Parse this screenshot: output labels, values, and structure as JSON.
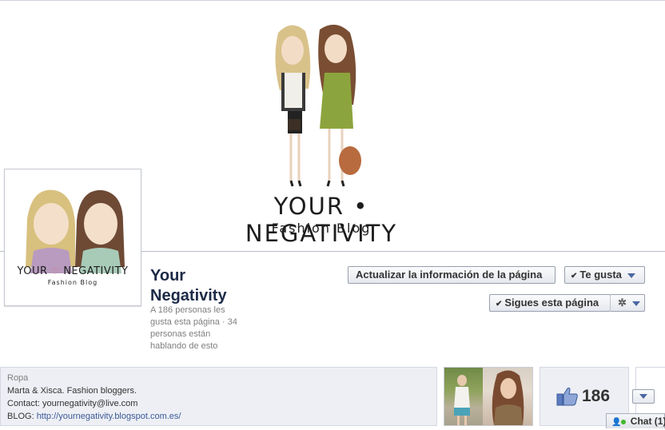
{
  "cover": {
    "brand": "YOUR • NEGATIVITY",
    "subtitle": "Fashion Blog"
  },
  "profile": {
    "brand_left": "YOUR",
    "heart": "♡",
    "brand_right": "NEGATIVITY",
    "subtitle": "Fashion Blog"
  },
  "page": {
    "name": "Your Negativity",
    "stats": "A 186 personas les gusta esta página · 34 personas están hablando de esto"
  },
  "actions": {
    "update_label": "Actualizar la información de la página",
    "like_label": "Te gusta",
    "follow_label": "Sigues esta página",
    "check_icon": "check-icon",
    "gear_icon": "gear-icon"
  },
  "about": {
    "category": "Ropa",
    "line1": "Marta & Xisca. Fashion bloggers.",
    "line2": "Contact: yournegativity@live.com",
    "blog_label": "BLOG:",
    "blog_url": "http://yournegativity.blogspot.com.es/"
  },
  "likes": {
    "count": "186"
  },
  "chat": {
    "label": "Chat (1)"
  },
  "colors": {
    "link": "#3b5998",
    "name": "#1c2a47",
    "online": "#42b72a"
  }
}
